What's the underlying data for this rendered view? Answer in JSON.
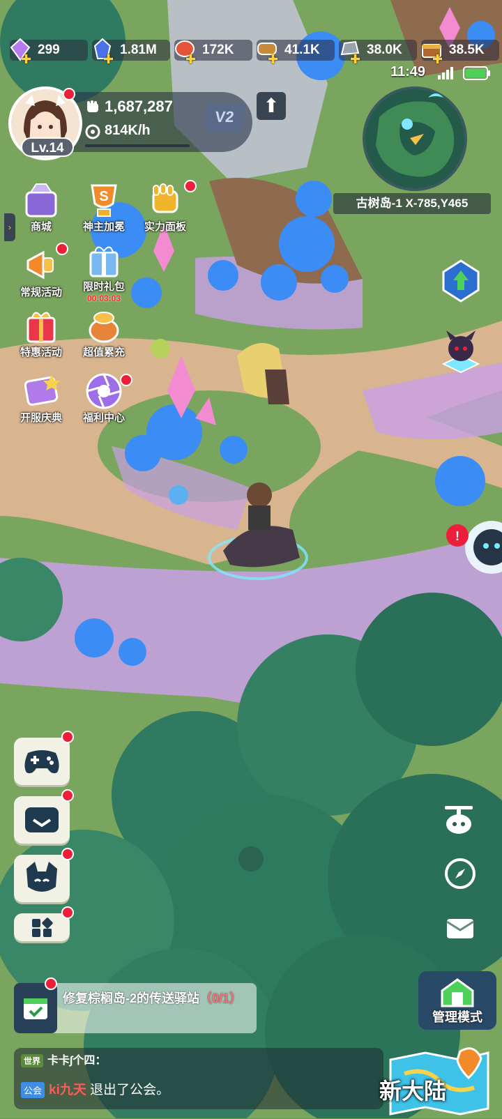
{
  "resources": [
    {
      "icon": "purple-gem-icon",
      "value": "299"
    },
    {
      "icon": "blue-crystal-icon",
      "value": "1.81M"
    },
    {
      "icon": "meat-food-icon",
      "value": "172K"
    },
    {
      "icon": "wood-log-icon",
      "value": "41.1K"
    },
    {
      "icon": "stone-ore-icon",
      "value": "38.0K"
    },
    {
      "icon": "treasure-chest-icon",
      "value": "38.5K"
    }
  ],
  "status_bar": {
    "time": "11:49"
  },
  "player": {
    "level": "Lv.14",
    "power": "1,687,287",
    "rate": "814K/h",
    "vip": "V2"
  },
  "activities": [
    {
      "label": "商城"
    },
    {
      "label": "神主加冕"
    },
    {
      "label": "实力面板"
    },
    {
      "label": "常规活动"
    },
    {
      "label": "限时礼包",
      "timer": "00:03:03"
    },
    {
      "label": "特惠活动"
    },
    {
      "label": "超值累充"
    },
    {
      "label": "开服庆典"
    },
    {
      "label": "福利中心"
    }
  ],
  "minimap": {
    "location": "古树岛-1 X-785,Y465"
  },
  "quest": {
    "text": "修复棕榈岛-2的传送驿站",
    "progress": "（0/1）"
  },
  "chat": {
    "world_channel": "世界",
    "world_text": "卡卡∫个四：",
    "guild_channel": "公会",
    "guild_user": "ki九天",
    "guild_text": " 退出了公会。"
  },
  "buttons": {
    "manage_mode": "管理模式",
    "new_continent": "新大陆"
  },
  "colors": {
    "notification": "#ec1f3b",
    "flower_blue": "#3b8cf5",
    "grass_pink": "#c9a0e6"
  }
}
